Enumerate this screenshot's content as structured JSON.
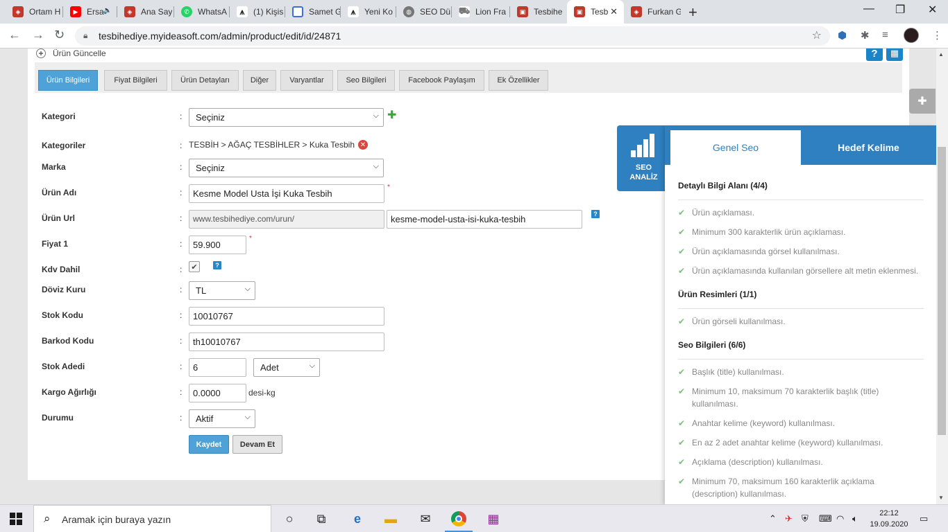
{
  "browser": {
    "tabs": [
      {
        "title": "Ortam H",
        "icon": "shield-icon",
        "color": "#c0392b"
      },
      {
        "title": "Ersa",
        "icon": "youtube-icon",
        "color": "#ff0000"
      },
      {
        "title": "Ana Say",
        "icon": "shield-icon",
        "color": "#c0392b"
      },
      {
        "title": "WhatsA",
        "icon": "whatsapp-icon",
        "color": "#25d366"
      },
      {
        "title": "(1) Kişis",
        "icon": "tree-icon",
        "color": "#333333"
      },
      {
        "title": "Samet G",
        "icon": "shield-outline-icon",
        "color": "#3b6ee0"
      },
      {
        "title": "Yeni Ko",
        "icon": "tree-icon",
        "color": "#333333"
      },
      {
        "title": "SEO Dü",
        "icon": "globe-icon",
        "color": "#777777"
      },
      {
        "title": "Lion Fra",
        "icon": "cart-icon",
        "color": "#777777"
      },
      {
        "title": "Tesbihe",
        "icon": "bag-icon",
        "color": "#c0392b"
      },
      {
        "title": "Tesb",
        "icon": "bag-icon",
        "color": "#c0392b"
      },
      {
        "title": "Furkan G",
        "icon": "shield-icon",
        "color": "#c0392b"
      }
    ],
    "active_tab_index": 10,
    "url": "tesbihediye.myideasoft.com/admin/product/edit/id/24871"
  },
  "page": {
    "title": "Ürün Güncelle",
    "help_label": "?",
    "tabs": [
      "Ürün Bilgileri",
      "Fiyat Bilgileri",
      "Ürün Detayları",
      "Diğer",
      "Varyantlar",
      "Seo Bilgileri",
      "Facebook Paylaşım",
      "Ek Özellikler"
    ],
    "active_tab": "Ürün Bilgileri",
    "form": {
      "colon": ":",
      "required_mark": "*",
      "help_mark": "?",
      "kategori": {
        "label": "Kategori",
        "value": "Seçiniz"
      },
      "kategoriler": {
        "label": "Kategoriler",
        "value": "TESBİH > AĞAÇ TESBİHLER > Kuka Tesbih"
      },
      "marka": {
        "label": "Marka",
        "value": "Seçiniz"
      },
      "urun_adi": {
        "label": "Ürün Adı",
        "value": "Kesme Model Usta İşi Kuka Tesbih"
      },
      "urun_url": {
        "label": "Ürün Url",
        "prefix": "www.tesbihediye.com/urun/",
        "value": "kesme-model-usta-isi-kuka-tesbih"
      },
      "fiyat": {
        "label": "Fiyat 1",
        "value": "59.900"
      },
      "kdv": {
        "label": "Kdv Dahil",
        "checked": true
      },
      "doviz": {
        "label": "Döviz Kuru",
        "value": "TL"
      },
      "stok_kodu": {
        "label": "Stok Kodu",
        "value": "10010767"
      },
      "barkod": {
        "label": "Barkod Kodu",
        "value": "th10010767"
      },
      "stok_adedi": {
        "label": "Stok Adedi",
        "value": "6",
        "unit": "Adet"
      },
      "kargo": {
        "label": "Kargo Ağırlığı",
        "value": "0.0000",
        "unit": "desi-kg"
      },
      "durum": {
        "label": "Durumu",
        "value": "Aktif"
      },
      "save_label": "Kaydet",
      "continue_label": "Devam Et"
    }
  },
  "seo": {
    "badge_line1": "SEO",
    "badge_line2": "ANALİZ",
    "tab_general": "Genel Seo",
    "tab_target": "Hedef Kelime",
    "sections": [
      {
        "title": "Detaylı Bilgi Alanı (4/4)",
        "items": [
          "Ürün açıklaması.",
          "Minimum 300 karakterlik ürün açıklaması.",
          "Ürün açıklamasında görsel kullanılması.",
          "Ürün açıklamasında kullanılan görsellere alt metin eklenmesi."
        ]
      },
      {
        "title": "Ürün Resimleri (1/1)",
        "items": [
          "Ürün görseli kullanılması."
        ]
      },
      {
        "title": "Seo Bilgileri (6/6)",
        "items": [
          "Başlık (title) kullanılması.",
          "Minimum 10, maksimum 70 karakterlik başlık (title) kullanılması.",
          "Anahtar kelime (keyword) kullanılması.",
          "En az 2 adet anahtar kelime (keyword) kullanılması.",
          "Açıklama (description) kullanılması.",
          "Minimum 70, maksimum 160 karakterlik açıklama (description) kullanılması."
        ]
      }
    ]
  },
  "taskbar": {
    "search_placeholder": "Aramak için buraya yazın",
    "time": "22:12",
    "date": "19.09.2020"
  }
}
